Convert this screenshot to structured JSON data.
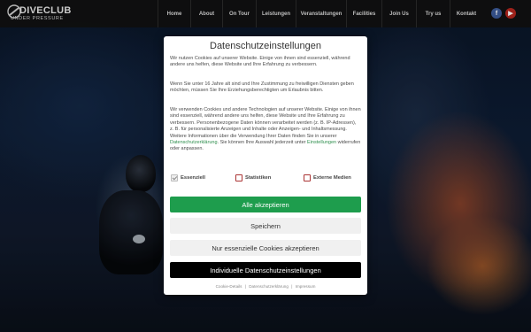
{
  "header": {
    "logo_title": "DIVECLUB",
    "logo_subtitle": "UNDER PRESSURE",
    "nav": [
      {
        "label": "Home"
      },
      {
        "label": "About"
      },
      {
        "label": "On Tour"
      },
      {
        "label": "Leistungen"
      },
      {
        "label": "Veranstaltungen"
      },
      {
        "label": "Facilities"
      },
      {
        "label": "Join Us"
      },
      {
        "label": "Try us"
      },
      {
        "label": "Kontakt"
      }
    ],
    "social": {
      "facebook": "f",
      "youtube": "▶"
    }
  },
  "modal": {
    "title": "Datenschutzeinstellungen",
    "paragraph1": "Wir nutzen Cookies auf unserer Website. Einige von ihnen sind essenziell, während andere uns helfen, diese Website und Ihre Erfahrung zu verbessern.",
    "paragraph2": "Wenn Sie unter 16 Jahre alt sind und Ihre Zustimmung zu freiwilligen Diensten geben möchten, müssen Sie Ihre Erziehungsberechtigten um Erlaubnis bitten.",
    "paragraph3_a": "Wir verwenden Cookies und andere Technologien auf unserer Website. Einige von ihnen sind essenziell, während andere uns helfen, diese Website und Ihre Erfahrung zu verbessern. Personenbezogene Daten können verarbeitet werden (z. B. IP-Adressen), z. B. für personalisierte Anzeigen und Inhalte oder Anzeigen- und Inhaltsmessung. Weitere Informationen über die Verwendung Ihrer Daten finden Sie in unserer ",
    "paragraph3_link1": "Datenschutzerklärung",
    "paragraph3_b": ". Sie können Ihre Auswahl jederzeit unter ",
    "paragraph3_link2": "Einstellungen",
    "paragraph3_c": " widerrufen oder anpassen.",
    "checkboxes": [
      {
        "label": "Essenziell",
        "checked": true
      },
      {
        "label": "Statistiken",
        "checked": false
      },
      {
        "label": "Externe Medien",
        "checked": false
      }
    ],
    "buttons": {
      "accept_all": "Alle akzeptieren",
      "save": "Speichern",
      "essential_only": "Nur essenzielle Cookies akzeptieren",
      "individual": "Individuelle Datenschutzeinstellungen"
    },
    "footer_links": [
      "Cookie-Details",
      "Datenschutzerklärung",
      "Impressum"
    ],
    "footer_separator": "|"
  },
  "colors": {
    "accent_green": "#1e9d4d",
    "link_green": "#2f8f4e",
    "header_bg": "#121212",
    "facebook": "#3b5998",
    "youtube": "#b3261e"
  }
}
